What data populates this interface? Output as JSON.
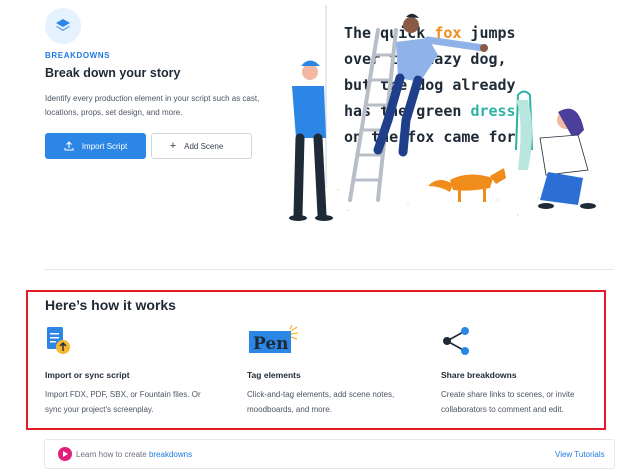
{
  "header": {
    "eyebrow": "BREAKDOWNS",
    "title": "Break down your story",
    "description": "Identify every production element in your script such as cast, locations, props, set design, and more."
  },
  "actions": {
    "import_label": "Import Script",
    "add_scene_label": "Add Scene"
  },
  "illustration": {
    "lines": [
      [
        "The ",
        "quick",
        " ",
        "fox",
        " jumps"
      ],
      [
        "over the lazy dog,"
      ],
      [
        "but the dog already"
      ],
      [
        "has the green ",
        "dress"
      ],
      [
        "on the fox came for"
      ]
    ],
    "highlight_colors": {
      "fox": "#f08c1a",
      "dress": "#2bb3a3"
    }
  },
  "how": {
    "title": "Here’s how it works",
    "steps": [
      {
        "icon": "document-upload-icon",
        "title": "Import or sync script",
        "desc_line1": "Import FDX, PDF, SBX, or Fountain files. Or",
        "desc_line2": "sync your project's screenplay."
      },
      {
        "icon": "pen-tag-icon",
        "title": "Tag elements",
        "desc_line1": "Click-and-tag elements, add scene notes,",
        "desc_line2": "moodboards, and more."
      },
      {
        "icon": "share-icon",
        "title": "Share breakdowns",
        "desc_line1": "Create share links to scenes, or invite",
        "desc_line2": "collaborators to comment and edit."
      }
    ]
  },
  "tutorial": {
    "prefix": "Learn how to create ",
    "link": "breakdowns",
    "view_label": "View Tutorials"
  },
  "colors": {
    "accent": "#2b86e6",
    "highlight_box": "#e01b24",
    "play": "#e0207a"
  }
}
